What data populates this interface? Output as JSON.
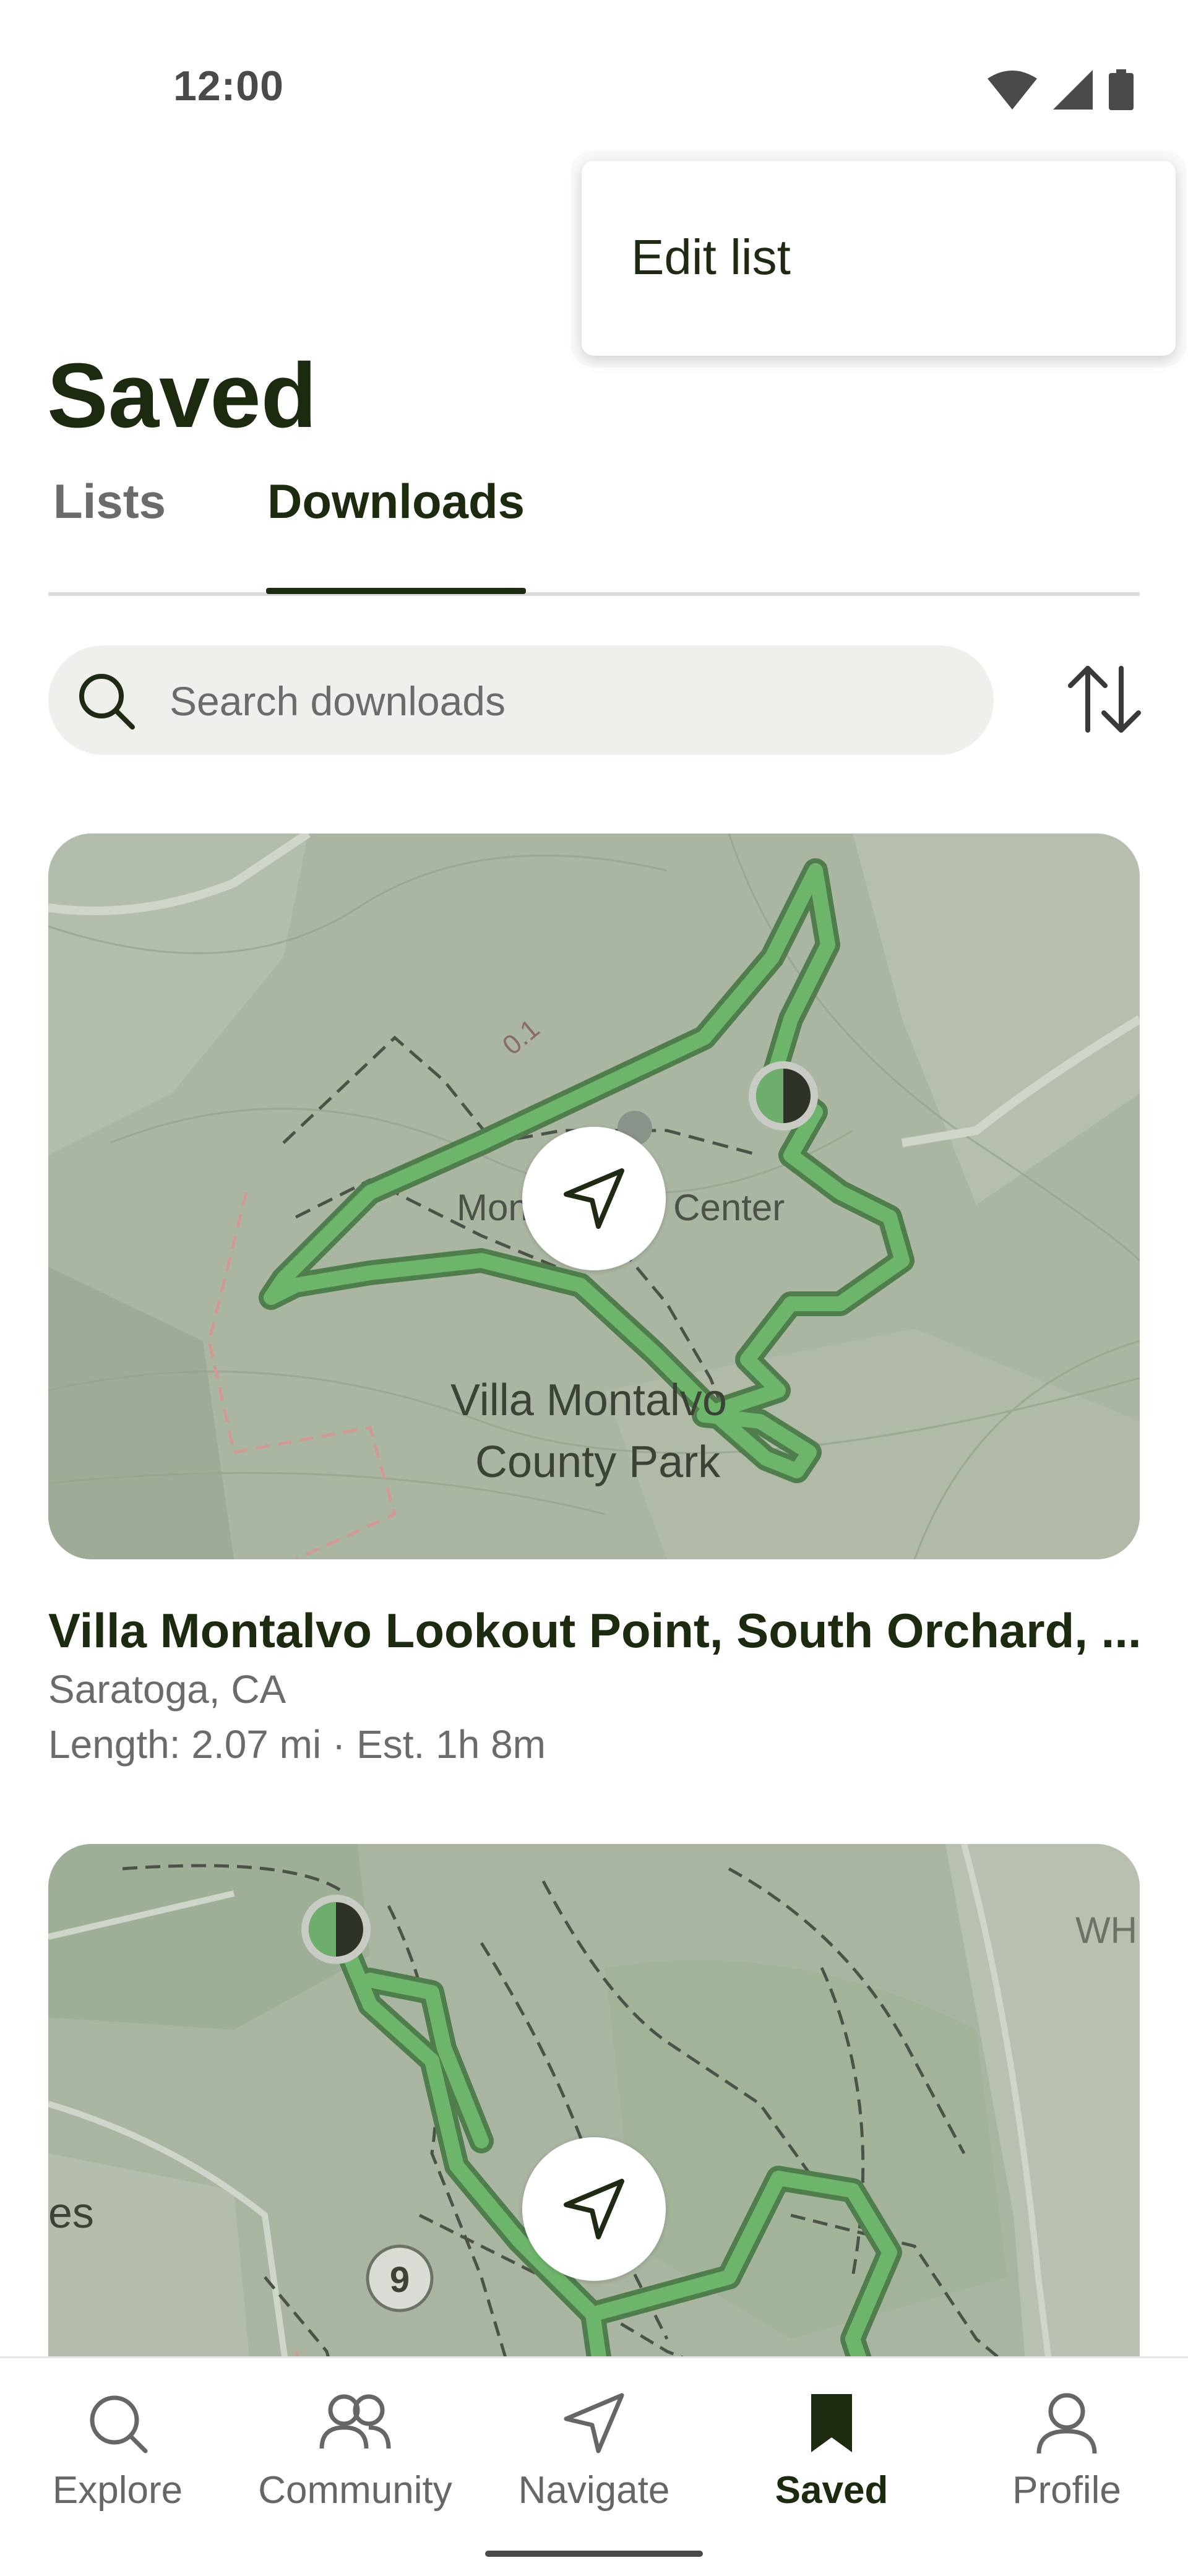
{
  "status_bar": {
    "time": "12:00",
    "icons": [
      "wifi-icon",
      "signal-icon",
      "battery-icon"
    ]
  },
  "menu": {
    "edit_list": "Edit list"
  },
  "header": {
    "title": "Saved"
  },
  "tabs": [
    {
      "label": "Lists",
      "selected": false
    },
    {
      "label": "Downloads",
      "selected": true
    }
  ],
  "search": {
    "placeholder": "Search downloads"
  },
  "cards": [
    {
      "map_labels": [
        "Montalvo Art Center",
        "Villa Montalvo",
        "County Park",
        "0.1"
      ],
      "title": "Villa Montalvo Lookout Point, South Orchard, ...",
      "location": "Saratoga, CA",
      "stats": "Length: 2.07 mi · Est. 1h 8m"
    },
    {
      "map_labels": [
        "WH",
        "es",
        "9"
      ]
    }
  ],
  "bottom_nav": [
    {
      "label": "Explore",
      "icon": "search-icon",
      "active": false
    },
    {
      "label": "Community",
      "icon": "people-icon",
      "active": false
    },
    {
      "label": "Navigate",
      "icon": "navigate-icon",
      "active": false
    },
    {
      "label": "Saved",
      "icon": "bookmark-icon",
      "active": true
    },
    {
      "label": "Profile",
      "icon": "profile-icon",
      "active": false
    }
  ],
  "colors": {
    "trail": "#6cae6a",
    "map_bg": "#a9b5a0",
    "text_dark": "#1c2a0f",
    "accent_tab": "#1c2a0f"
  }
}
